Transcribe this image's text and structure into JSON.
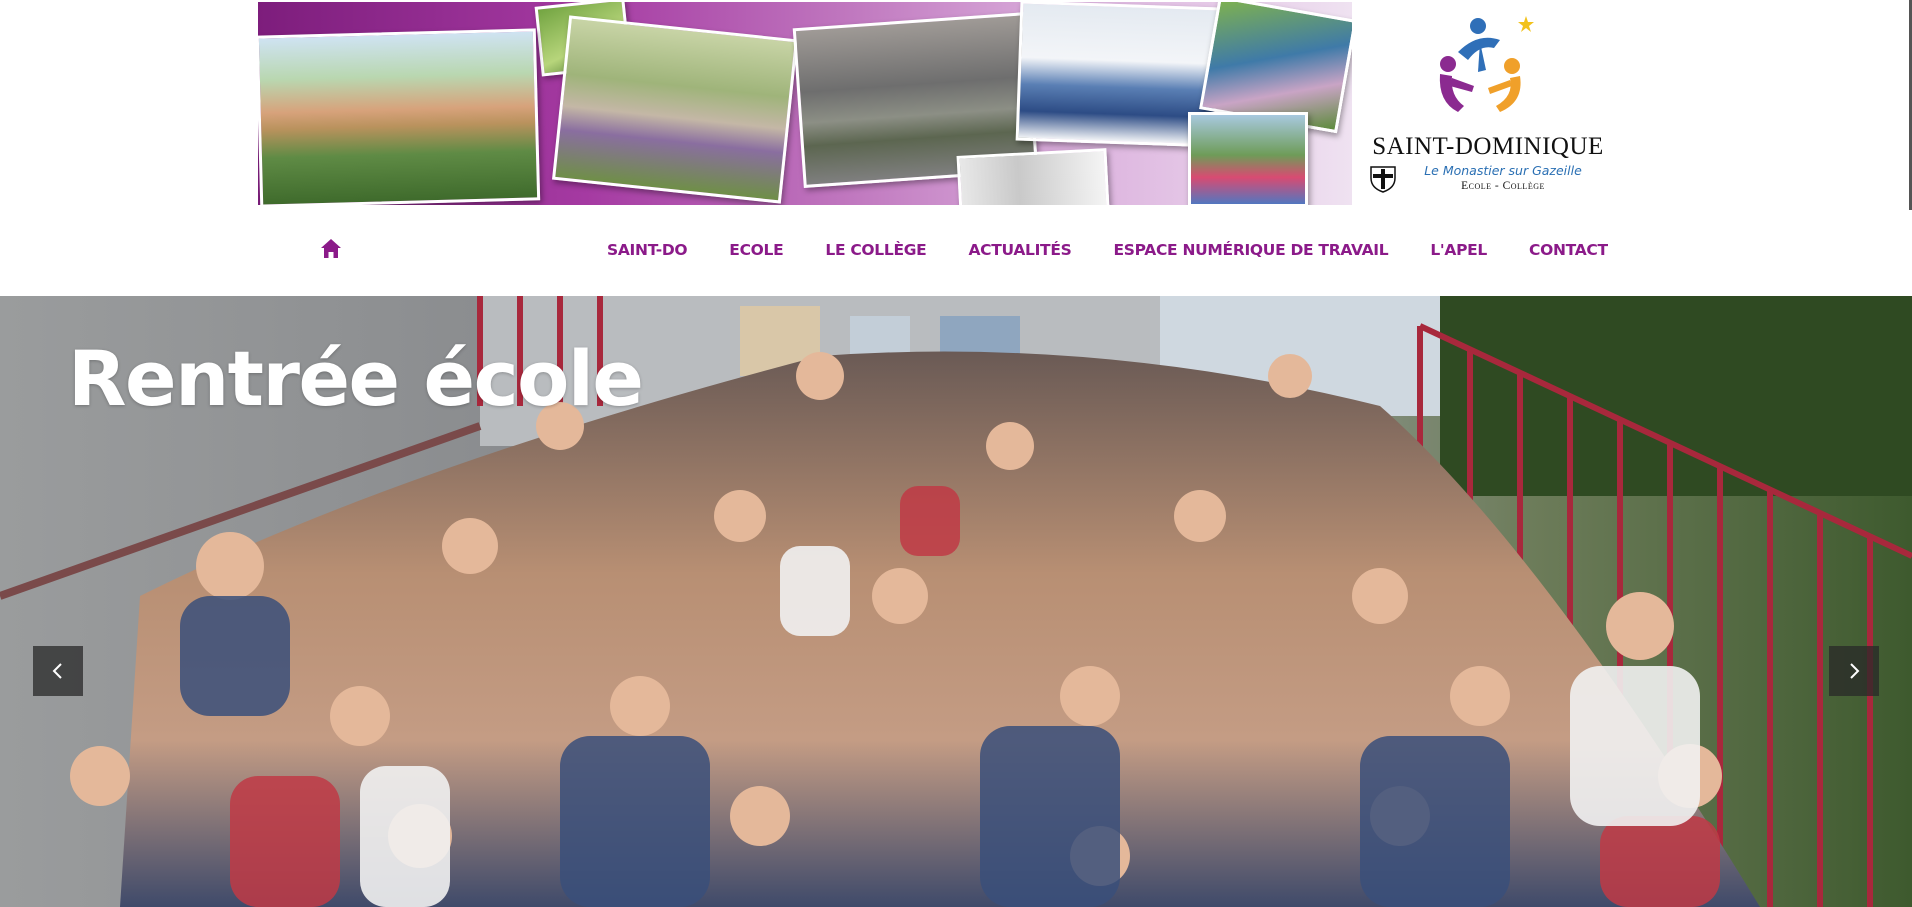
{
  "header": {
    "logo": {
      "name": "Saint-Dominique",
      "location": "Le Monastier sur Gazeille",
      "level": "Ecole - Collège"
    }
  },
  "nav": {
    "home_icon": "home-icon",
    "items": [
      {
        "label": "SAINT-DO"
      },
      {
        "label": "ECOLE"
      },
      {
        "label": "LE COLLÈGE"
      },
      {
        "label": "ACTUALITÉS"
      },
      {
        "label": "ESPACE NUMÉRIQUE DE TRAVAIL"
      },
      {
        "label": "L'APEL"
      },
      {
        "label": "CONTACT"
      }
    ],
    "color": "#8b1a89"
  },
  "slider": {
    "title": "Rentrée école",
    "prev_icon": "chevron-left-icon",
    "next_icon": "chevron-right-icon"
  },
  "colors": {
    "brand_purple": "#8b1a89",
    "logo_blue": "#2a6fb3"
  }
}
